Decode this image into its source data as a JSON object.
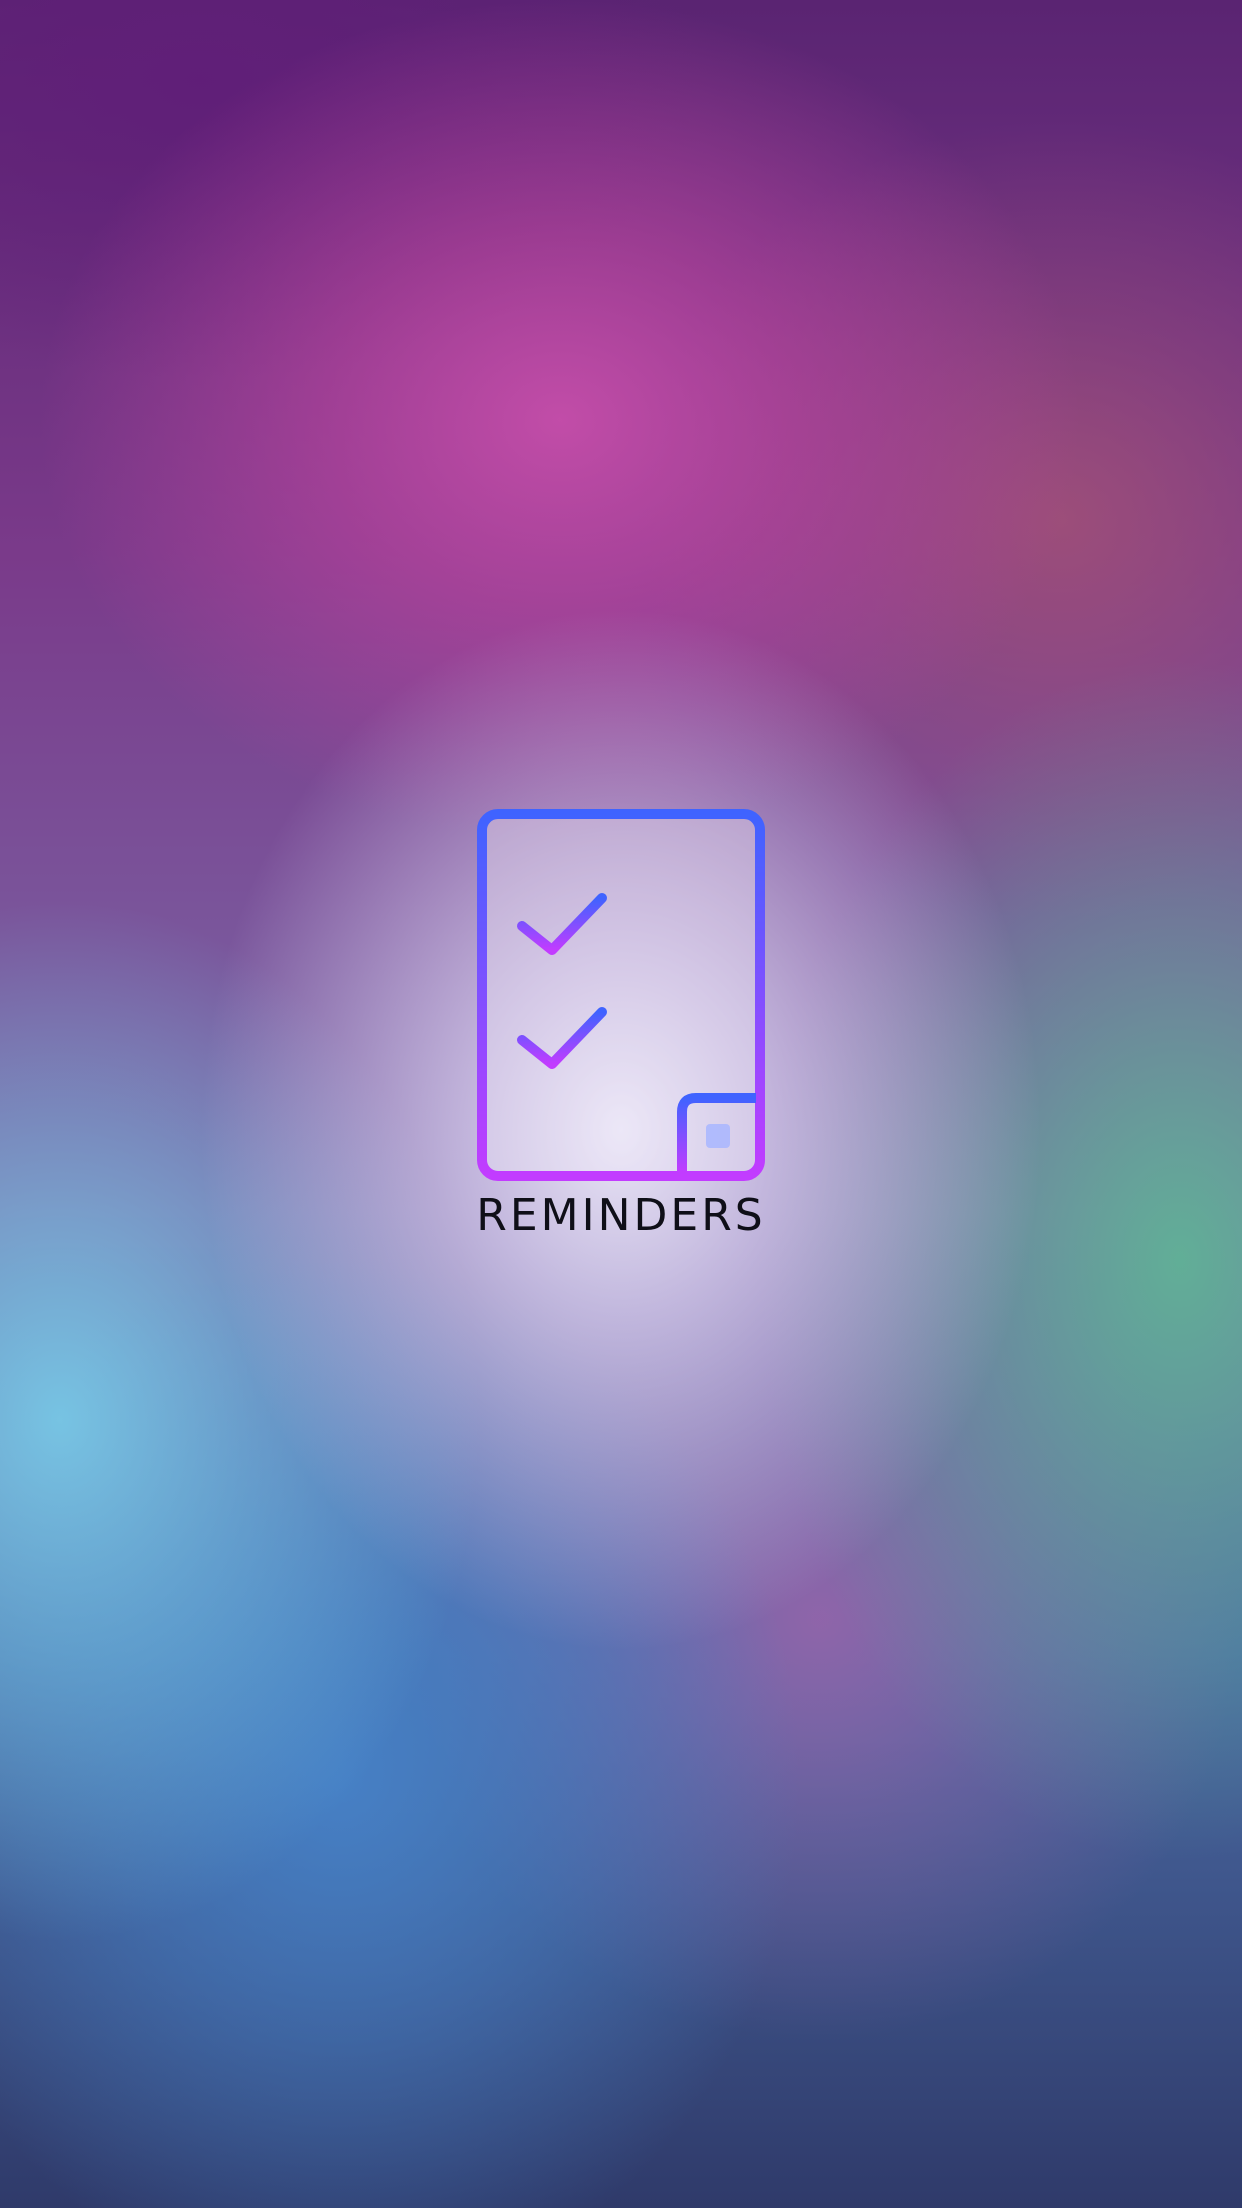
{
  "app": {
    "name": "REMINDERS",
    "icon": "checklist-icon"
  },
  "colors": {
    "icon_gradient_top": "#3f63ff",
    "icon_gradient_bottom": "#c23cff",
    "text": "#0f0f18"
  }
}
